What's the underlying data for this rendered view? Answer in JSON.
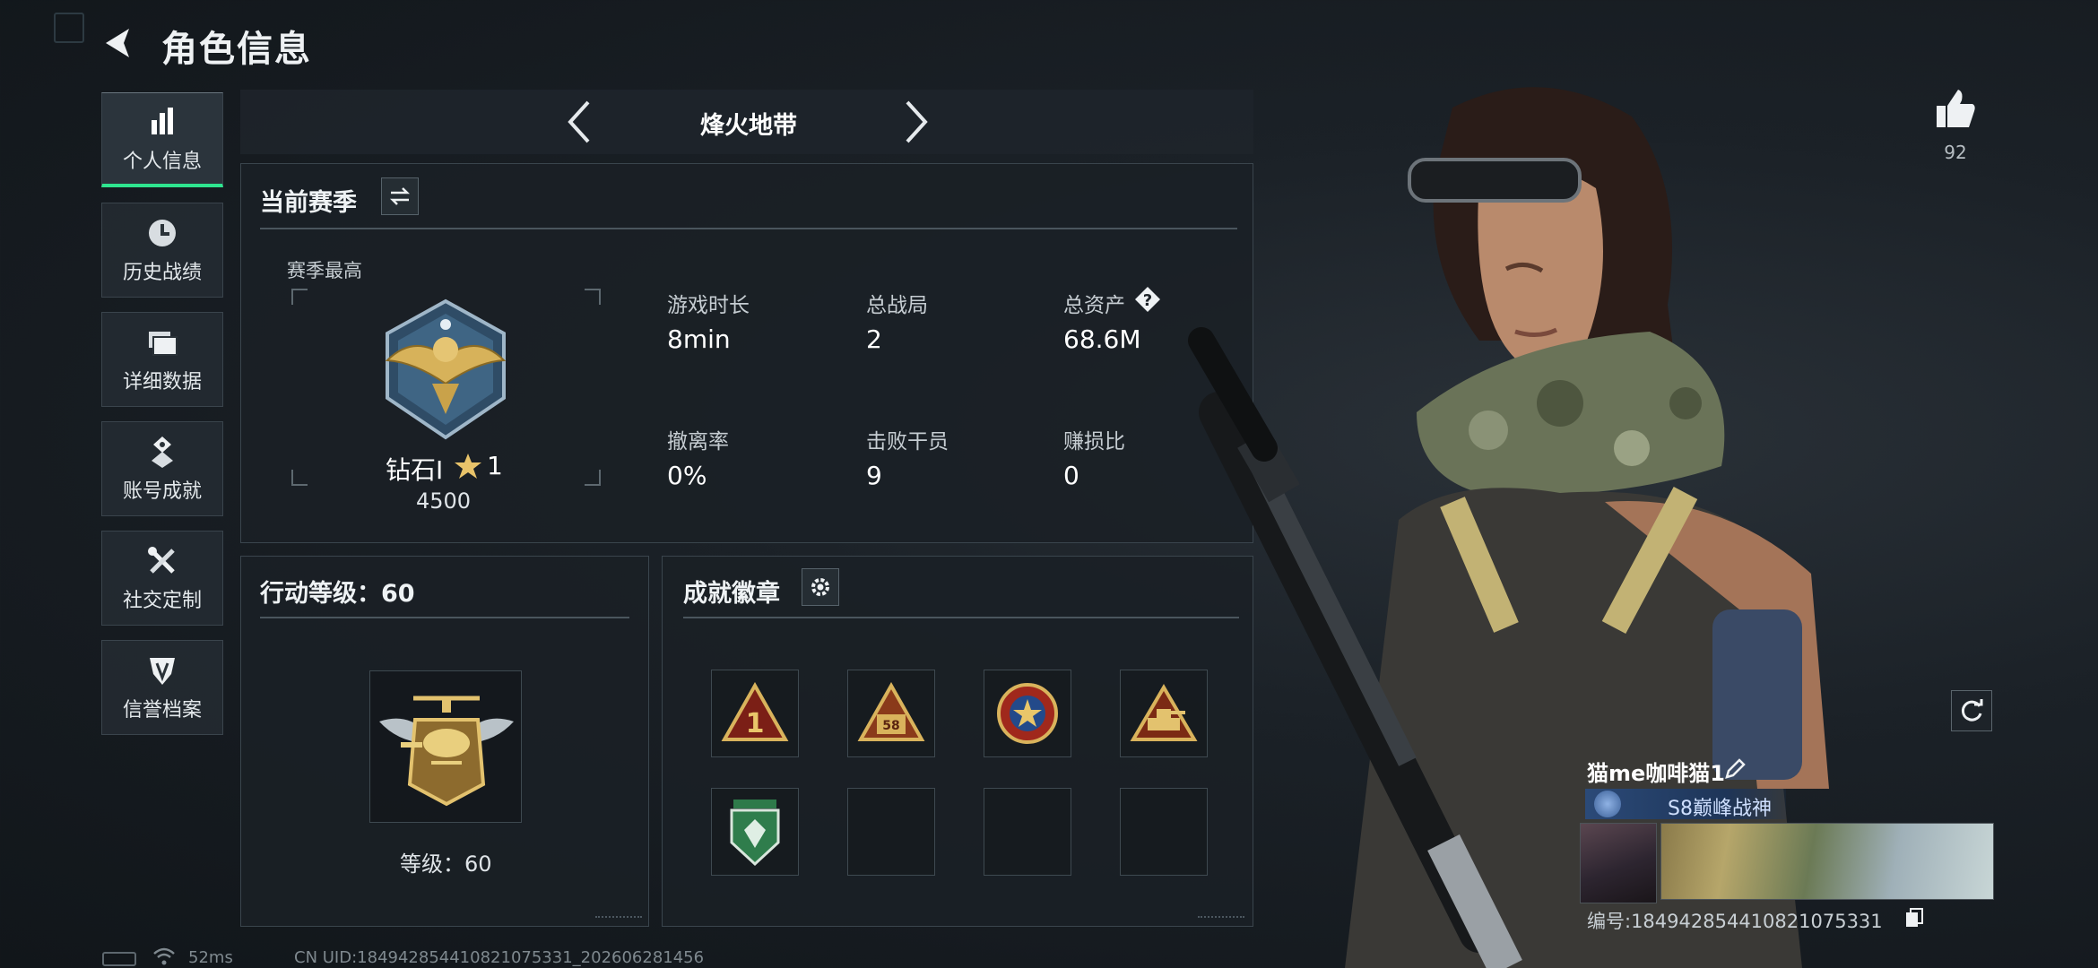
{
  "header": {
    "title": "角色信息"
  },
  "sidebar": {
    "items": [
      {
        "label": "个人信息",
        "icon": "bar-chart-icon",
        "active": true
      },
      {
        "label": "历史战绩",
        "icon": "clock-icon",
        "active": false
      },
      {
        "label": "详细数据",
        "icon": "folder-icon",
        "active": false
      },
      {
        "label": "账号成就",
        "icon": "achievement-icon",
        "active": false
      },
      {
        "label": "社交定制",
        "icon": "tools-icon",
        "active": false
      },
      {
        "label": "信誉档案",
        "icon": "shield-icon",
        "active": false
      }
    ]
  },
  "mode_selector": {
    "current": "烽火地带"
  },
  "season": {
    "title": "当前赛季",
    "peak_label": "赛季最高",
    "rank_name": "钻石I",
    "rank_stars": "1",
    "rank_points": "4500",
    "stats": [
      {
        "label": "游戏时长",
        "value": "8min"
      },
      {
        "label": "总战局",
        "value": "2"
      },
      {
        "label": "总资产",
        "value": "68.6M",
        "has_help": true
      },
      {
        "label": "撤离率",
        "value": "0%"
      },
      {
        "label": "击败干员",
        "value": "9"
      },
      {
        "label": "赚损比",
        "value": "0"
      }
    ]
  },
  "action_level": {
    "title": "行动等级：60",
    "level_label": "等级：60"
  },
  "badges": {
    "title": "成就徽章",
    "slots": [
      {
        "filled": true,
        "icon": "triangle-1-badge-icon"
      },
      {
        "filled": true,
        "icon": "triangle-58-badge-icon"
      },
      {
        "filled": true,
        "icon": "star-medal-badge-icon"
      },
      {
        "filled": true,
        "icon": "tank-triangle-badge-icon"
      },
      {
        "filled": true,
        "icon": "green-shield-badge-icon"
      },
      {
        "filled": false,
        "icon": ""
      },
      {
        "filled": false,
        "icon": ""
      },
      {
        "filled": false,
        "icon": ""
      }
    ]
  },
  "profile": {
    "likes": "92",
    "player_name": "猫me咖啡猫1",
    "title": "S8巅峰战神",
    "uid_label": "编号:18494285441082107533​1"
  },
  "footer": {
    "ping": "52ms",
    "cn_uid": "CN UID:18494285441082107533​1_202606281456"
  },
  "colors": {
    "accent_green": "#2ee58f",
    "panel_bg": "#1a2026",
    "gold": "#c9a24a"
  }
}
